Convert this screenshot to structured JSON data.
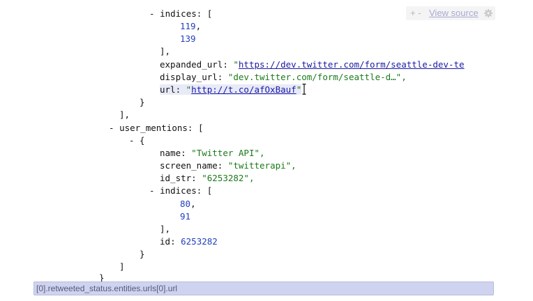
{
  "toolbar": {
    "plus_minus": "+ -",
    "view_source": "View source",
    "gear_icon": "gear-icon"
  },
  "json": {
    "indices_key": "indices",
    "indices_values": [
      "119",
      "139"
    ],
    "expanded_url_key": "expanded_url",
    "expanded_url_value": "https://dev.twitter.com/form/seattle-dev-te",
    "display_url_key": "display_url",
    "display_url_value": "\"dev.twitter.com/form/seattle-d…\",",
    "url_key": "url",
    "url_value": "http://t.co/afOxBauf",
    "user_mentions_key": "user_mentions",
    "name_key": "name",
    "name_value": "\"Twitter API\",",
    "screen_name_key": "screen_name",
    "screen_name_value": "\"twitterapi\",",
    "id_str_key": "id_str",
    "id_str_value": "\"6253282\",",
    "mention_indices_key": "indices",
    "mention_indices_values": [
      "80",
      "91"
    ],
    "id_key": "id",
    "id_value": "6253282"
  },
  "statusbar": {
    "path": "[0].retweeted_status.entities.urls[0].url"
  },
  "colors": {
    "string": "#1b7a1b",
    "number": "#1f3fbf",
    "link": "#1a1aa6",
    "statusbar_bg": "#cfd3ef"
  }
}
